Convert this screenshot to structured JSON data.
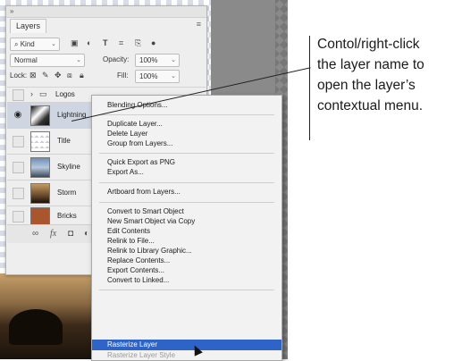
{
  "panel": {
    "tab": "Layers",
    "filter_kind": "Kind",
    "blend_mode": "Normal",
    "opacity_label": "Opacity:",
    "opacity_value": "100%",
    "lock_label": "Lock:",
    "fill_label": "Fill:",
    "fill_value": "100%",
    "group_name": "Logos",
    "layers": [
      {
        "name": "Lightning",
        "visible": true
      },
      {
        "name": "Title",
        "visible": false
      },
      {
        "name": "Skyline",
        "visible": false
      },
      {
        "name": "Storm",
        "visible": false
      },
      {
        "name": "Bricks",
        "visible": false
      }
    ]
  },
  "menu": {
    "items": [
      "Blending Options...",
      "Duplicate Layer...",
      "Delete Layer",
      "Group from Layers...",
      "Quick Export as PNG",
      "Export As...",
      "Artboard from Layers...",
      "Convert to Smart Object",
      "New Smart Object via Copy",
      "Edit Contents",
      "Relink to File...",
      "Relink to Library Graphic...",
      "Replace Contents...",
      "Export Contents...",
      "Convert to Linked...",
      "Rasterize Layer",
      "Rasterize Layer Style"
    ],
    "highlighted": "Rasterize Layer",
    "colors": {
      "highlight": "#2e63c7"
    }
  },
  "callout": {
    "lines": [
      "Contol/right-click",
      "the layer name to",
      "open the layer’s",
      "contextual menu."
    ]
  }
}
